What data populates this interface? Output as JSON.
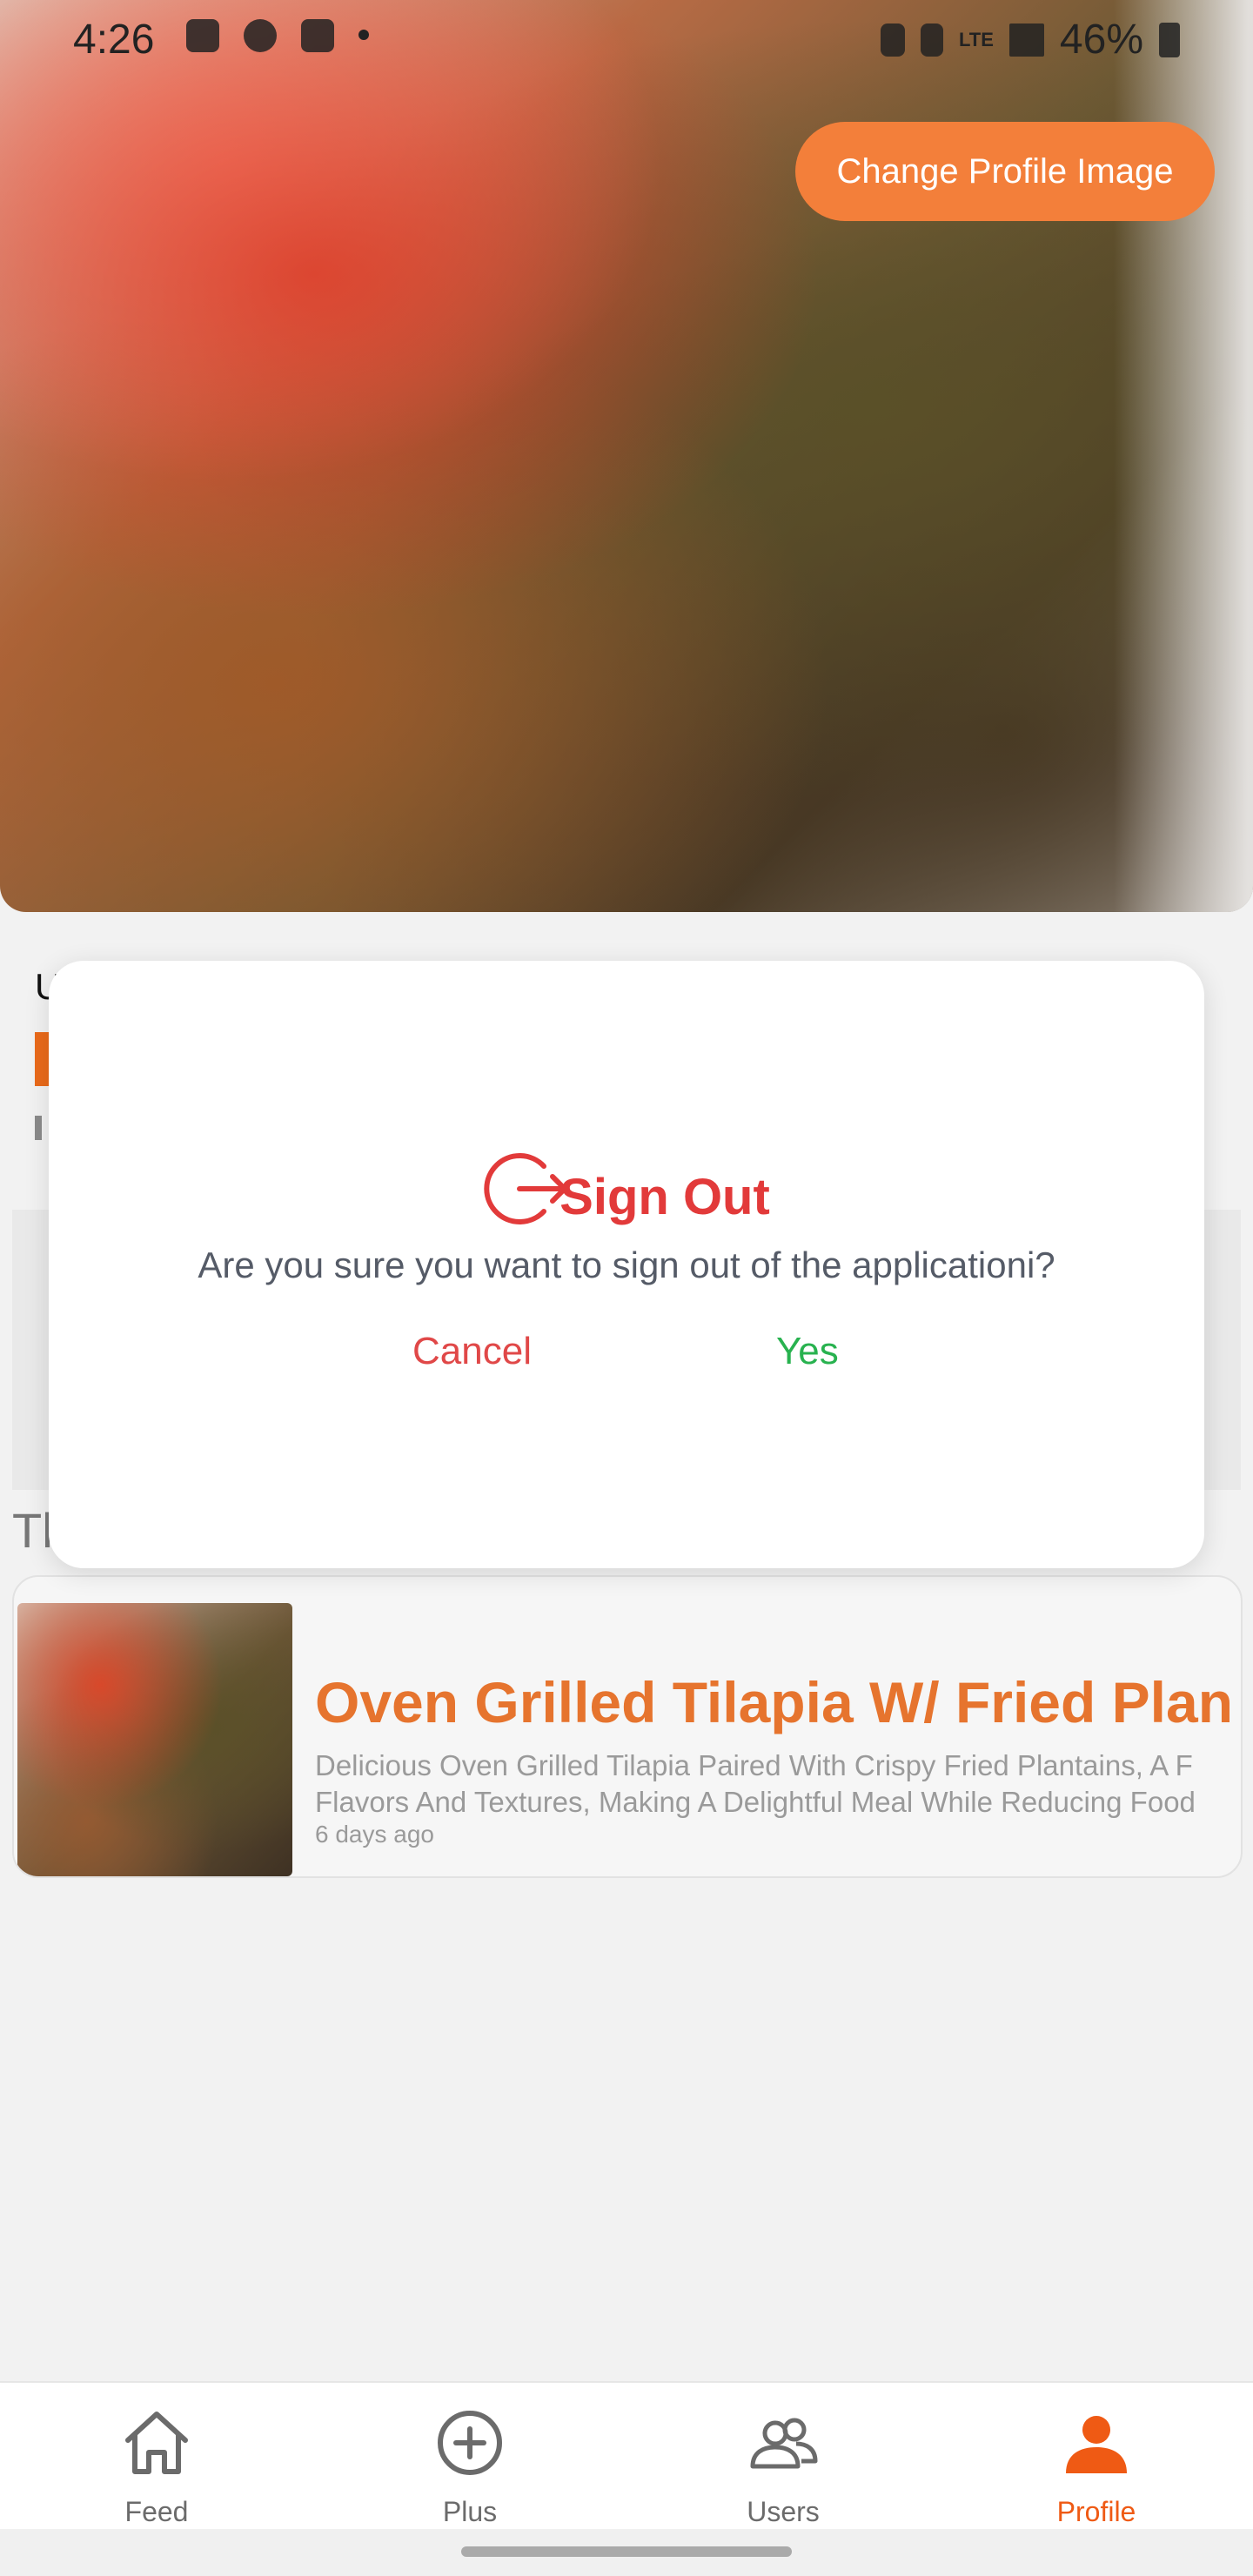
{
  "status_bar": {
    "time": "4:26",
    "battery": "46%",
    "network": "LTE"
  },
  "profile": {
    "change_image_label": "Change Profile Image",
    "name_partial": "U",
    "section_title_partial": "Tl"
  },
  "post": {
    "title": "Oven Grilled Tilapia W/ Fried Plan",
    "description_line1": "Delicious Oven Grilled Tilapia Paired With Crispy Fried Plantains, A F",
    "description_line2": "Flavors And Textures, Making A Delightful Meal While Reducing Food",
    "time_ago": "6 days ago"
  },
  "dialog": {
    "title": "Sign Out",
    "message": "Are you sure you want to sign out of the applicationi?",
    "cancel_label": "Cancel",
    "confirm_label": "Yes",
    "colors": {
      "title": "#e23a3a",
      "cancel": "#e04848",
      "confirm": "#28b24f"
    }
  },
  "bottom_nav": {
    "items": [
      {
        "label": "Feed",
        "icon": "home-icon"
      },
      {
        "label": "Plus",
        "icon": "plus-circle-icon"
      },
      {
        "label": "Users",
        "icon": "users-icon"
      },
      {
        "label": "Profile",
        "icon": "profile-icon"
      }
    ],
    "active_color": "#ef5a14"
  },
  "colors": {
    "accent_orange": "#f37f3a"
  }
}
